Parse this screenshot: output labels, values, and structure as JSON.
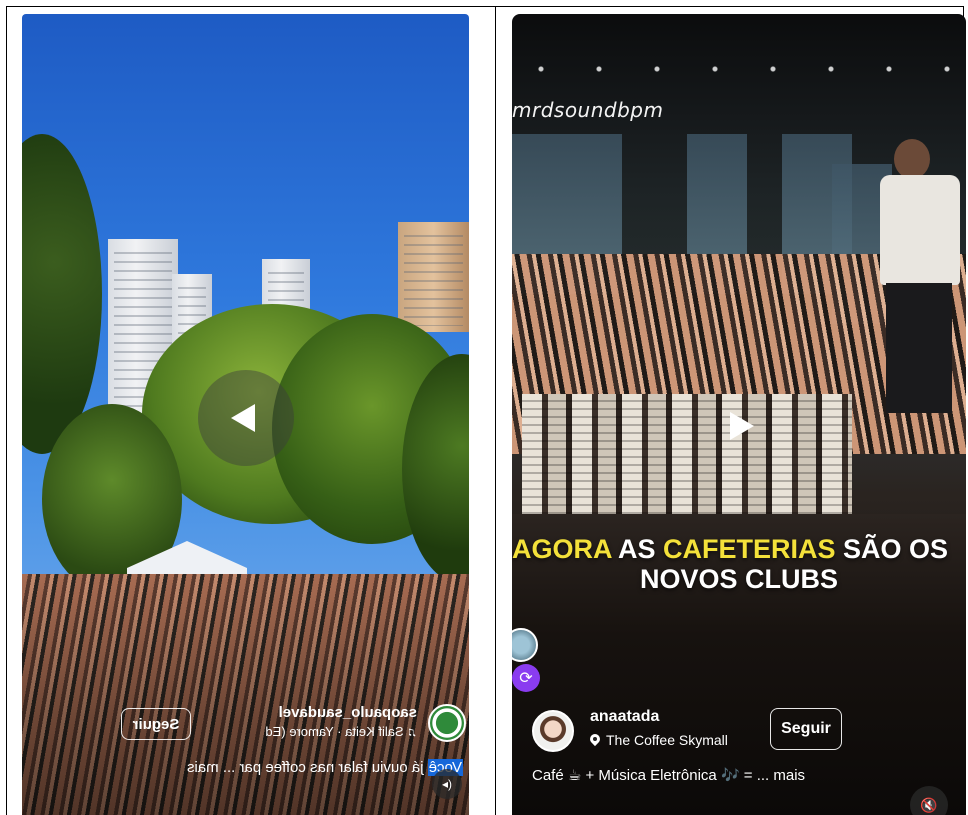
{
  "left_reel": {
    "username": "saopaulo_saudavel",
    "music_icon": "music-note-icon",
    "music": "Salif Keita · Yamore (Ed",
    "follow_label": "Seguir",
    "caption_highlight": "Você",
    "caption_text": " já ouviu falar nas coffee par ... mais",
    "mute_icon": "speaker-icon",
    "play_icon": "play-icon"
  },
  "right_reel": {
    "watermark": "mrdsoundbpm",
    "headline": {
      "agora": "AGORA",
      "as": " AS ",
      "cafeterias": "CAFETERIAS",
      "sao_os": " SÃO OS",
      "line2": "NOVOS CLUBS"
    },
    "username": "anaatada",
    "location": "The Coffee Skymall",
    "follow_label": "Seguir",
    "caption": "Café ☕ + Música Eletrônica 🎶 = ... mais",
    "mute_icon": "speaker-muted-icon",
    "play_icon": "play-icon",
    "collab_icon": "repost-icon"
  },
  "colors": {
    "headline_accent": "#f4e13a",
    "caption_highlight_bg": "#1667d9",
    "badge_purple": "#8a3cf0"
  }
}
